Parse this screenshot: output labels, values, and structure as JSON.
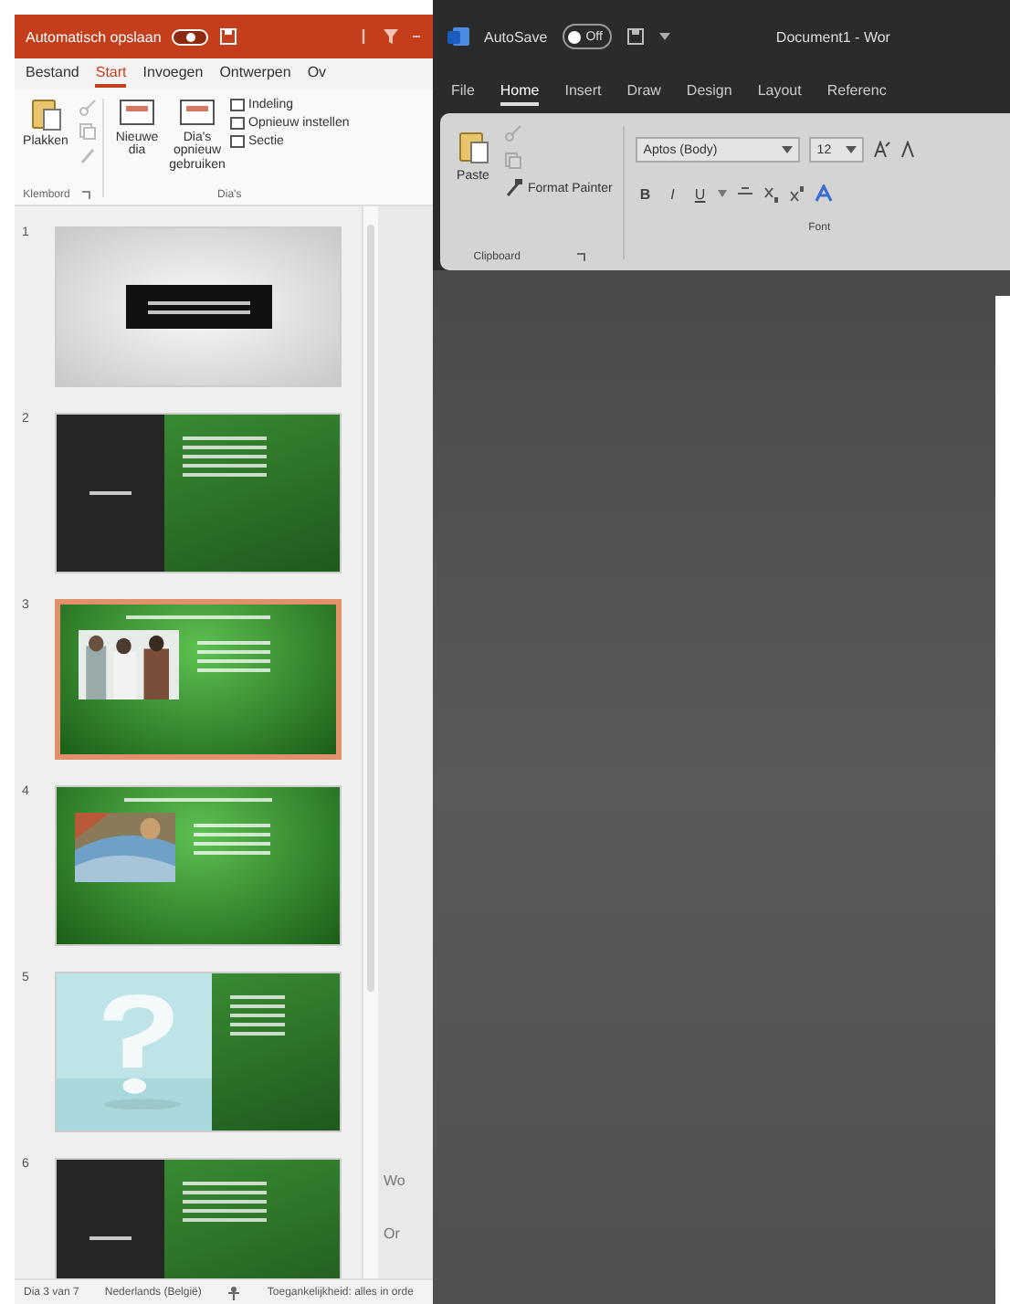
{
  "powerpoint": {
    "title_bar": {
      "autosave_label": "Automatisch opslaan",
      "autosave_on": false
    },
    "tabs": [
      {
        "label": "Bestand",
        "selected": false
      },
      {
        "label": "Start",
        "selected": true
      },
      {
        "label": "Invoegen",
        "selected": false
      },
      {
        "label": "Ontwerpen",
        "selected": false
      },
      {
        "label": "Ov",
        "selected": false
      }
    ],
    "ribbon": {
      "paste": "Plakken",
      "clipboard_label": "Klembord",
      "new_slide": "Nieuwe dia",
      "reuse": "Dia's opnieuw gebruiken",
      "options": [
        "Indeling",
        "Opnieuw instellen",
        "Sectie"
      ],
      "slides_label": "Dia's"
    },
    "slides": [
      {
        "number": "1",
        "kind": "title",
        "selected": false
      },
      {
        "number": "2",
        "kind": "split",
        "selected": false
      },
      {
        "number": "3",
        "selected": true
      },
      {
        "number": "4",
        "selected": false
      },
      {
        "number": "5",
        "kind": "question",
        "selected": false
      },
      {
        "number": "6",
        "kind": "split",
        "selected": false
      }
    ],
    "notes_peek": [
      "Wo",
      "Or"
    ],
    "status_bar": [
      "Dia 3 van 7",
      "Nederlands (België)",
      "Toegankelijkheid: alles in orde"
    ]
  },
  "word": {
    "title_bar": {
      "autosave_label": "AutoSave",
      "autosave_on": false,
      "autosave_state": "Off",
      "document_title": "Document1 - Wor"
    },
    "tabs": [
      {
        "label": "File",
        "selected": false
      },
      {
        "label": "Home",
        "selected": true
      },
      {
        "label": "Insert",
        "selected": false
      },
      {
        "label": "Draw",
        "selected": false
      },
      {
        "label": "Design",
        "selected": false
      },
      {
        "label": "Layout",
        "selected": false
      },
      {
        "label": "Referenc",
        "selected": false
      }
    ],
    "ribbon": {
      "paste": "Paste",
      "format_painter": "Format Painter",
      "clipboard_label": "Clipboard",
      "font_name": "Aptos (Body)",
      "font_size": "12",
      "font_label": "Font",
      "format_buttons": [
        "B",
        "I",
        "U"
      ]
    }
  }
}
